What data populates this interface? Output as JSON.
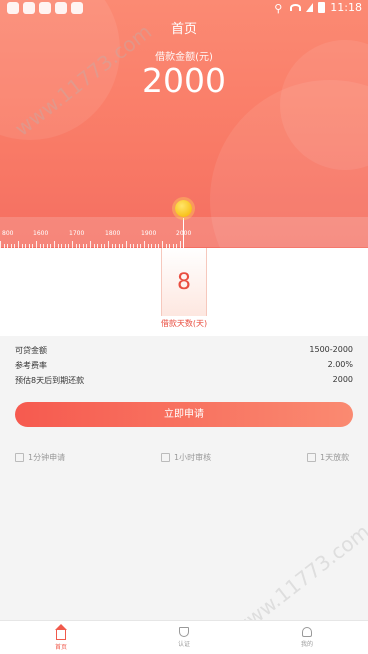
{
  "status_bar": {
    "time": "11:18"
  },
  "header": {
    "title": "首页",
    "amount_label": "借款金额(元)",
    "amount_value": "2000"
  },
  "ruler": {
    "labels": [
      "800",
      "1600",
      "1700",
      "1800",
      "1900",
      "2000"
    ],
    "selected": "2000"
  },
  "days": {
    "value": "8",
    "label": "借款天数(天)"
  },
  "info": [
    {
      "label": "可贷金额",
      "value": "1500-2000"
    },
    {
      "label": "参考费率",
      "value": "2.00%"
    },
    {
      "label": "预估8天后到期还款",
      "value": "2000"
    }
  ],
  "apply_button": "立即申请",
  "features": [
    "1分钟申请",
    "1小时审核",
    "1天放款"
  ],
  "tabs": [
    {
      "label": "首页",
      "icon": "home-icon",
      "active": true
    },
    {
      "label": "认证",
      "icon": "shield-icon",
      "active": false
    },
    {
      "label": "我的",
      "icon": "user-icon",
      "active": false
    }
  ],
  "watermark": "www.11773.com",
  "colors": {
    "accent": "#f05a4c",
    "header": "#f97a66",
    "knob": "#f8c21d"
  }
}
